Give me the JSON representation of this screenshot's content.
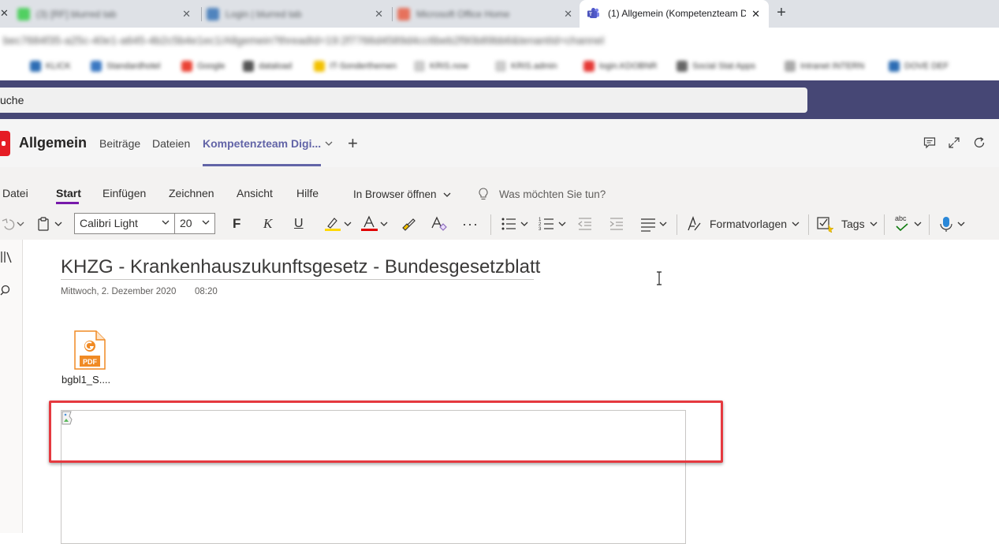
{
  "browser": {
    "tabs": [
      {
        "label": "(3) [RF] blurred tab",
        "blurred": true,
        "color": "#2ecc40"
      },
      {
        "label": "Login | blurred tab",
        "blurred": true,
        "color": "#2d6db4"
      },
      {
        "label": "Microsoft Office Home",
        "blurred": true,
        "color": "#e8563a"
      },
      {
        "label": "(1) Allgemein (Kompetenzteam D",
        "blurred": false,
        "color": "#6264a7"
      }
    ],
    "close_glyph": "✕",
    "new_tab_glyph": "+",
    "url": "bec7684f35-a25c-40e1-a645-4b2c5b4e1ec1/Allgemein?threadId=19:2f7766d4589d4cc6beb2f90b89bb6&tenantId=channel",
    "bookmarks": [
      "KLICK",
      "Standardhotel",
      "Google",
      "dataload",
      "IT-Sonderthemen",
      "KRIS.now",
      "KRIS.admin",
      "login.KDOBNR",
      "Social Stat Apps",
      "Intranet INTERN",
      "DOVE DEF"
    ]
  },
  "teams": {
    "search_text": "uche",
    "channel_name": "Allgemein",
    "tabs": [
      "Beiträge",
      "Dateien",
      "Kompetenzteam Digi..."
    ],
    "add_tab_glyph": "+",
    "header_icons": [
      "conversation-icon",
      "expand-icon",
      "refresh-icon"
    ]
  },
  "onenote": {
    "menu": [
      "Datei",
      "Start",
      "Einfügen",
      "Zeichnen",
      "Ansicht",
      "Hilfe"
    ],
    "active_menu": "Start",
    "open_in_browser": "In Browser öffnen",
    "tell_me": "Was möchten Sie tun?",
    "font_name": "Calibri Light",
    "font_size": "20",
    "bold_glyph": "F",
    "italic_glyph": "K",
    "underline_glyph": "U",
    "styles_label": "Formatvorlagen",
    "tags_label": "Tags",
    "spell_label": "abc",
    "accent_color": "#7719aa",
    "highlight_color": "#ffd800",
    "font_color": "#e00000"
  },
  "page": {
    "title": "KHZG - Krankenhauszukunftsgesetz - Bundesgesetzblatt",
    "date": "Mittwoch, 2. Dezember 2020",
    "time": "08:20",
    "attachment": {
      "name": "bgbl1_S....",
      "type_label": "PDF",
      "icon": "pdf-file-icon"
    },
    "highlight_color": "#e5393f"
  }
}
